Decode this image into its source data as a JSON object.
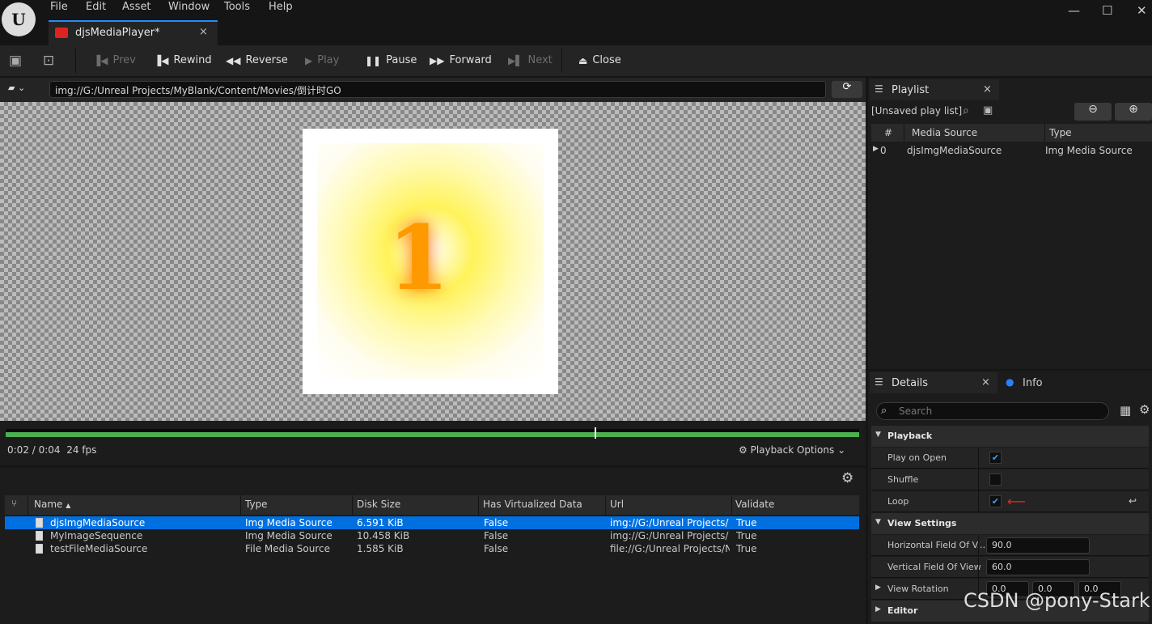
{
  "menu": [
    "File",
    "Edit",
    "Asset",
    "Window",
    "Tools",
    "Help"
  ],
  "tab": {
    "title": "djsMediaPlayer*",
    "close": "×"
  },
  "window_controls": {
    "minimize": "—",
    "maximize": "☐",
    "close": "✕"
  },
  "toolbar": {
    "prev": "Prev",
    "rewind": "Rewind",
    "reverse": "Reverse",
    "play": "Play",
    "pause": "Pause",
    "forward": "Forward",
    "next": "Next",
    "close": "Close"
  },
  "url": "img://G:/Unreal Projects/MyBlank/Content/Movies/倒计时GO",
  "preview": {
    "number": "1"
  },
  "playback": {
    "time": "0:02 / 0:04",
    "fps": "24 fps",
    "options_label": "Playback Options",
    "progress": 0.5
  },
  "content_browser": {
    "columns": [
      "Name",
      "Type",
      "Disk Size",
      "Has Virtualized Data",
      "Url",
      "Validate"
    ],
    "rows": [
      {
        "name": "djsImgMediaSource",
        "type": "Img Media Source",
        "size": "6.591 KiB",
        "virt": "False",
        "url": "img://G:/Unreal Projects/",
        "valid": "True",
        "selected": true
      },
      {
        "name": "MyImageSequence",
        "type": "Img Media Source",
        "size": "10.458 KiB",
        "virt": "False",
        "url": "img://G:/Unreal Projects/",
        "valid": "True",
        "selected": false
      },
      {
        "name": "testFileMediaSource",
        "type": "File Media Source",
        "size": "1.585 KiB",
        "virt": "False",
        "url": "file://G:/Unreal Projects/N",
        "valid": "True",
        "selected": false
      }
    ]
  },
  "playlist": {
    "tab": "Playlist",
    "title": "[Unsaved play list]",
    "columns": [
      "#",
      "Media Source",
      "Type"
    ],
    "rows": [
      {
        "index": "0",
        "source": "djsImgMediaSource",
        "type": "Img Media Source"
      }
    ]
  },
  "details": {
    "tab": "Details",
    "info_tab": "Info",
    "search_placeholder": "Search",
    "playback_category": "Playback",
    "play_on_open": "Play on Open",
    "shuffle": "Shuffle",
    "loop": "Loop",
    "play_on_open_checked": true,
    "shuffle_checked": false,
    "loop_checked": true,
    "view_settings_category": "View Settings",
    "hfov_label": "Horizontal Field Of V...",
    "hfov": "90.0",
    "vfov_label": "Vertical Field Of View",
    "vfov": "60.0",
    "rotation_label": "View Rotation",
    "rot_x": "0.0",
    "rot_y": "0.0",
    "rot_z": "0.0",
    "editor_category": "Editor"
  },
  "watermark": "CSDN @pony-Stark",
  "colors": {
    "accent": "#0070e0",
    "progress": "#4caf50",
    "arrow": "#ff2020"
  }
}
